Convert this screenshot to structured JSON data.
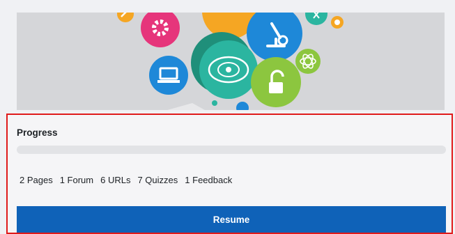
{
  "course_card": {
    "image_icons": [
      "gear-icon",
      "microscope-icon",
      "laptop-icon",
      "solar-system-icon",
      "atom-icon",
      "unlock-icon",
      "flask-icon"
    ],
    "colors": {
      "pink": "#e6357b",
      "orange": "#f5a623",
      "teal": "#2bb5a0",
      "blue": "#1e88d8",
      "green": "#8cc63f",
      "panel_border": "#e01a1a",
      "button": "#0f62b8"
    }
  },
  "progress": {
    "label": "Progress",
    "value_percent": 0
  },
  "activities": [
    "2 Pages",
    "1 Forum",
    "6 URLs",
    "7 Quizzes",
    "1 Feedback"
  ],
  "resume_button": {
    "label": "Resume"
  }
}
